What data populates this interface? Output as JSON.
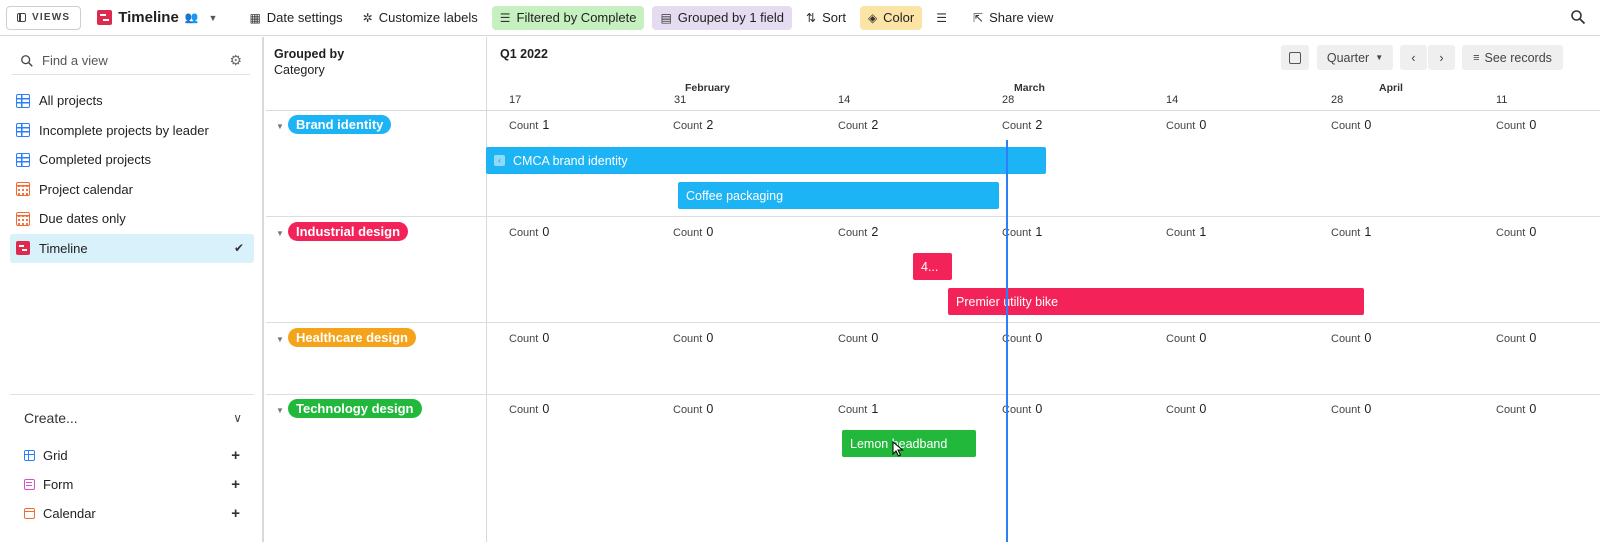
{
  "toolbar": {
    "views_label": "VIEWS",
    "view_title": "Timeline",
    "buttons": {
      "date_settings": "Date settings",
      "customize_labels": "Customize labels",
      "filtered": "Filtered by Complete",
      "grouped": "Grouped by 1 field",
      "sort": "Sort",
      "color": "Color",
      "share": "Share view"
    }
  },
  "sidebar": {
    "find_placeholder": "Find a view",
    "views": [
      {
        "label": "All projects",
        "icon": "grid-view-icon"
      },
      {
        "label": "Incomplete projects by leader",
        "icon": "grid-view-icon"
      },
      {
        "label": "Completed projects",
        "icon": "grid-view-icon"
      },
      {
        "label": "Project calendar",
        "icon": "calendar-view-icon"
      },
      {
        "label": "Due dates only",
        "icon": "calendar-view-icon"
      },
      {
        "label": "Timeline",
        "icon": "timeline-view-icon",
        "active": true
      }
    ],
    "create": {
      "label": "Create...",
      "items": [
        {
          "label": "Grid"
        },
        {
          "label": "Form"
        },
        {
          "label": "Calendar"
        }
      ]
    }
  },
  "timeline": {
    "grouped_by_label": "Grouped by",
    "grouped_by_field": "Category",
    "quarter": "Q1 2022",
    "scale_label": "Quarter",
    "see_records": "See records",
    "months": [
      "February",
      "March",
      "April"
    ],
    "days": [
      "17",
      "31",
      "14",
      "28",
      "14",
      "28",
      "11"
    ],
    "count_label": "Count",
    "groups": [
      {
        "name": "Brand identity",
        "color": "#1cb4f5",
        "counts": [
          "1",
          "2",
          "2",
          "2",
          "0",
          "0",
          "0"
        ],
        "bars": [
          {
            "label": "CMCA brand identity"
          },
          {
            "label": "Coffee packaging"
          }
        ]
      },
      {
        "name": "Industrial design",
        "color": "#f3235a",
        "counts": [
          "0",
          "0",
          "2",
          "1",
          "1",
          "1",
          "0"
        ],
        "bars": [
          {
            "label": "4..."
          },
          {
            "label": "Premier utility bike"
          }
        ]
      },
      {
        "name": "Healthcare design",
        "color": "#f5a31a",
        "counts": [
          "0",
          "0",
          "0",
          "0",
          "0",
          "0",
          "0"
        ],
        "bars": []
      },
      {
        "name": "Technology design",
        "color": "#22b83c",
        "counts": [
          "0",
          "0",
          "1",
          "0",
          "0",
          "0",
          "0"
        ],
        "bars": [
          {
            "label": "Lemon headband"
          }
        ]
      }
    ]
  },
  "colors": {
    "accent_blue": "#2d7ff9",
    "filter_green": "#c7f0c1",
    "group_purple": "#e5dcf2",
    "color_yellow": "#fbe4a6"
  }
}
